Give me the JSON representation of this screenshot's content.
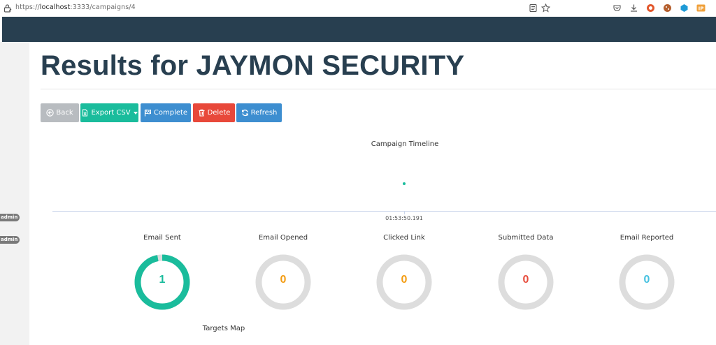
{
  "browser": {
    "url_scheme": "https://",
    "url_host": "localhost",
    "url_rest": ":3333/campaigns/4"
  },
  "sidebar": {
    "badges": [
      "admin",
      "admin"
    ]
  },
  "page": {
    "title": "Results for JAYMON SECURITY"
  },
  "toolbar": {
    "back_label": "Back",
    "export_label": "Export CSV",
    "complete_label": "Complete",
    "delete_label": "Delete",
    "refresh_label": "Refresh"
  },
  "timeline": {
    "title": "Campaign Timeline",
    "tick_label": "01:53:50.191"
  },
  "stats": [
    {
      "label": "Email Sent",
      "value": "1",
      "fraction": 0.97,
      "color": "#1abc9c"
    },
    {
      "label": "Email Opened",
      "value": "0",
      "fraction": 0,
      "color": "#f39c12"
    },
    {
      "label": "Clicked Link",
      "value": "0",
      "fraction": 0,
      "color": "#f39c12"
    },
    {
      "label": "Submitted Data",
      "value": "0",
      "fraction": 0,
      "color": "#e74c3c"
    },
    {
      "label": "Email Reported",
      "value": "0",
      "fraction": 0,
      "color": "#45c1e0"
    }
  ],
  "map": {
    "title": "Targets Map"
  },
  "colors": {
    "navbar": "#283f50",
    "ring_track": "#dddddd"
  }
}
